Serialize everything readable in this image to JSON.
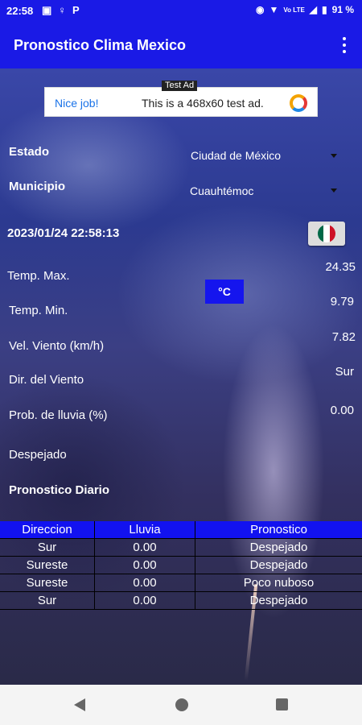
{
  "status": {
    "time": "22:58",
    "battery": "91 %",
    "network": "Vo LTE"
  },
  "app": {
    "title": "Pronostico Clima Mexico"
  },
  "ad": {
    "label": "Test Ad",
    "nice": "Nice job!",
    "text": "This is a 468x60 test ad."
  },
  "form": {
    "estado_label": "Estado",
    "estado_value": "Ciudad de México",
    "municipio_label": "Municipio",
    "municipio_value": "Cuauhtémoc"
  },
  "datetime": "2023/01/24 22:58:13",
  "unit_button": "°C",
  "weather": {
    "temp_max_label": "Temp. Max.",
    "temp_max": "24.35",
    "temp_min_label": "Temp. Min.",
    "temp_min": "9.79",
    "wind_speed_label": "Vel. Viento (km/h)",
    "wind_speed": "7.82",
    "wind_dir_label": "Dir. del Viento",
    "wind_dir": "Sur",
    "rain_label": "Prob. de lluvia (%)",
    "rain": "0.00",
    "sky": "Despejado"
  },
  "daily_label": "Pronostico Diario",
  "table": {
    "headers": [
      "Direccion",
      "Lluvia",
      "Pronostico"
    ],
    "rows": [
      [
        "Sur",
        "0.00",
        "Despejado"
      ],
      [
        "Sureste",
        "0.00",
        "Despejado"
      ],
      [
        "Sureste",
        "0.00",
        "Poco nuboso"
      ],
      [
        "Sur",
        "0.00",
        "Despejado"
      ]
    ]
  },
  "colors": {
    "primary": "#1a1ae6",
    "table_header": "#1212f0",
    "flag_green": "#006847",
    "flag_red": "#ce1126"
  }
}
